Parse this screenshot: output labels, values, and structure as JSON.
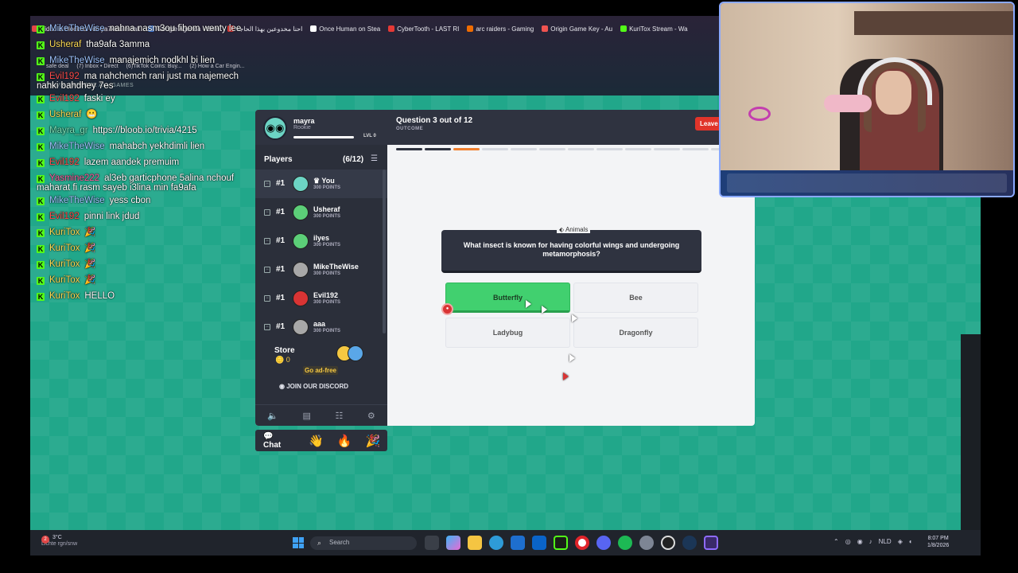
{
  "browser": {
    "tabs": [
      {
        "label": "Video is blocked - dc ya7kiou m3ak",
        "color": "#e54848"
      },
      {
        "label": "Google Agenda - Sem",
        "color": "#4285f4"
      },
      {
        "label": "احنا مخدوعين بهذا الحاجة",
        "color": "#e53935"
      },
      {
        "label": "Once Human on Stea",
        "color": "#ffffff"
      },
      {
        "label": "CyberTooth - LAST RI",
        "color": "#e53935"
      },
      {
        "label": "arc raiders - Gaming",
        "color": "#ef6c00"
      },
      {
        "label": "Origin Game Key - Au",
        "color": "#ef5350"
      },
      {
        "label": "KuriTox Stream - Wa",
        "color": "#53fc18"
      }
    ],
    "bookmarks": [
      "safe deal",
      "(7) Inbox • Direct",
      "(6)TikTok Coins: Buy...",
      "(2) How a Car Engin..."
    ],
    "behind_tabs": "TRIVIA   EXPLORE ALL GAMES"
  },
  "chat": {
    "lines": [
      {
        "user": "MikeTheWise",
        "user_color": "#9fc5ff",
        "text": "nahna nasm3ou fihom wenty lee"
      },
      {
        "user": "Usheraf",
        "user_color": "#ffdd55",
        "text": "tha9afa 3amma"
      },
      {
        "user": "MikeTheWise",
        "user_color": "#9fc5ff",
        "text": "manajemich nodkhl bi lien"
      },
      {
        "user": "Evil192",
        "user_color": "#ff4d4d",
        "text": "ma nahchemch rani just ma najemech nahki bahdhey 7es"
      },
      {
        "user": "Evil192",
        "user_color": "#ff4d4d",
        "text": "faski ey"
      },
      {
        "user": "Usheraf",
        "user_color": "#ffdd55",
        "text": "😬"
      },
      {
        "user": "Mayra_gr",
        "user_color": "#7ee2b8",
        "text": "https://bloob.io/trivia/4215"
      },
      {
        "user": "MikeTheWise",
        "user_color": "#9fc5ff",
        "text": "mahabch yekhdimli lien"
      },
      {
        "user": "Evil192",
        "user_color": "#ff4d4d",
        "text": "lazem aandek premuim"
      },
      {
        "user": "Yasmine222",
        "user_color": "#ff5fa2",
        "text": "al3eb garticphone 5alina nchouf maharat fi rasm sayeb i3lina min fa9afa"
      },
      {
        "user": "MikeTheWise",
        "user_color": "#9fc5ff",
        "text": "yess cbon"
      },
      {
        "user": "Evil192",
        "user_color": "#ff4d4d",
        "text": "pinni link jdud"
      },
      {
        "user": "KuriTox",
        "user_color": "#ffdd55",
        "text": "🎉"
      },
      {
        "user": "KuriTox",
        "user_color": "#ffdd55",
        "text": "🎉"
      },
      {
        "user": "KuriTox",
        "user_color": "#ffdd55",
        "text": "🎉"
      },
      {
        "user": "KuriTox",
        "user_color": "#ffdd55",
        "text": "🎉"
      },
      {
        "user": "KuriTox",
        "user_color": "#ffdd55",
        "text": "HELLO"
      }
    ]
  },
  "profile": {
    "name": "mayra",
    "rank": "Rookie",
    "level": "LVL 0",
    "avatar_color": "#6cd4c4"
  },
  "players": {
    "heading": "Players",
    "count": "(6/12)",
    "list": [
      {
        "rank": "#1",
        "name": "♛ You",
        "points": "300 POINTS",
        "avatar_color": "#6cd4c4"
      },
      {
        "rank": "#1",
        "name": "Usheraf",
        "points": "300 POINTS",
        "avatar_color": "#5ccf78"
      },
      {
        "rank": "#1",
        "name": "ilyes",
        "points": "300 POINTS",
        "avatar_color": "#5ccf78"
      },
      {
        "rank": "#1",
        "name": "MikeTheWise",
        "points": "300 POINTS",
        "avatar_color": "#a8a8a8"
      },
      {
        "rank": "#1",
        "name": "Evil192",
        "points": "300 POINTS",
        "avatar_color": "#d93434"
      },
      {
        "rank": "#1",
        "name": "aaa",
        "points": "300 POINTS",
        "avatar_color": "#a8a8a8"
      }
    ]
  },
  "store": {
    "label": "Store",
    "coins": "0",
    "adfree": "Go ad-free"
  },
  "discord": "JOIN OUR DISCORD",
  "game": {
    "question_count": "Question 3 out of 12",
    "phase": "OUTCOME",
    "leave": "Leave",
    "progress": {
      "total": 12,
      "done": 2,
      "current": 3
    },
    "category": "Animals",
    "question": "What insect is known for having colorful wings and undergoing metamorphosis?",
    "answers": [
      {
        "label": "Butterfly",
        "correct": true
      },
      {
        "label": "Bee",
        "correct": false
      },
      {
        "label": "Ladybug",
        "correct": false
      },
      {
        "label": "Dragonfly",
        "correct": false
      }
    ]
  },
  "reactions": {
    "chat_label": "Chat",
    "emojis": [
      "👋",
      "🔥",
      "🎉"
    ]
  },
  "taskbar": {
    "weather_temp": "3°C",
    "weather_desc": "Lichte rgn/snw",
    "weather_badge": "2",
    "search_placeholder": "Search",
    "language": "NLD",
    "time": "8:07 PM",
    "date": "1/8/2026"
  }
}
